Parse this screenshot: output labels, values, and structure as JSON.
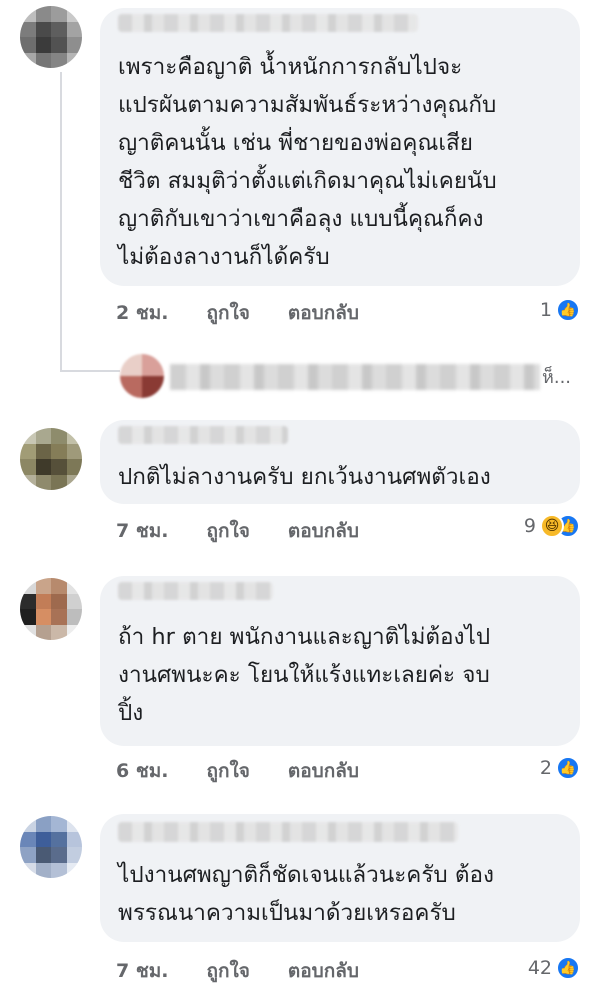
{
  "comments": [
    {
      "text": "เพราะคือญาติ น้ำหนักการกลับไปจะ\nแปรผันตามความสัมพันธ์ระหว่างคุณกับ\nญาติคนนั้น เช่น พี่ชายของพ่อคุณเสีย\nชีวิต สมมุติว่าตั้งแต่เกิดมาคุณไม่เคยนับ\nญาติกับเขาว่าเขาคือลุง แบบนี้คุณก็คง\nไม่ต้องลางานก็ได้ครับ",
      "time": "2 ชม.",
      "like": "ถูกใจ",
      "reply": "ตอบกลับ",
      "reaction_count": "1"
    },
    {
      "text": "ปกติไม่ลางานครับ ยกเว้นงานศพตัวเอง",
      "time": "7 ชม.",
      "like": "ถูกใจ",
      "reply": "ตอบกลับ",
      "reaction_count": "9"
    },
    {
      "text": "ถ้า hr ตาย พนักงานและญาติไม่ต้องไป\nงานศพนะคะ โยนให้แร้งแทะเลยค่ะ จบ\nปิ้ง",
      "time": "6 ชม.",
      "like": "ถูกใจ",
      "reply": "ตอบกลับ",
      "reaction_count": "2"
    },
    {
      "text": "ไปงานศพญาติก็ชัดเจนแล้วนะครับ ต้อง\nพรรณนาความเป็นมาด้วยเหรอครับ",
      "time": "7 ชม.",
      "like": "ถูกใจ",
      "reply": "ตอบกลับ",
      "reaction_count": "42"
    }
  ],
  "reply_preview": {
    "tail": "ห็..."
  },
  "icons": {
    "like": "like-icon",
    "haha": "haha-icon"
  },
  "colors": {
    "bubble": "#f0f2f5",
    "meta": "#65676b",
    "like_blue": "#1877f2",
    "haha_yellow": "#f7b928"
  }
}
